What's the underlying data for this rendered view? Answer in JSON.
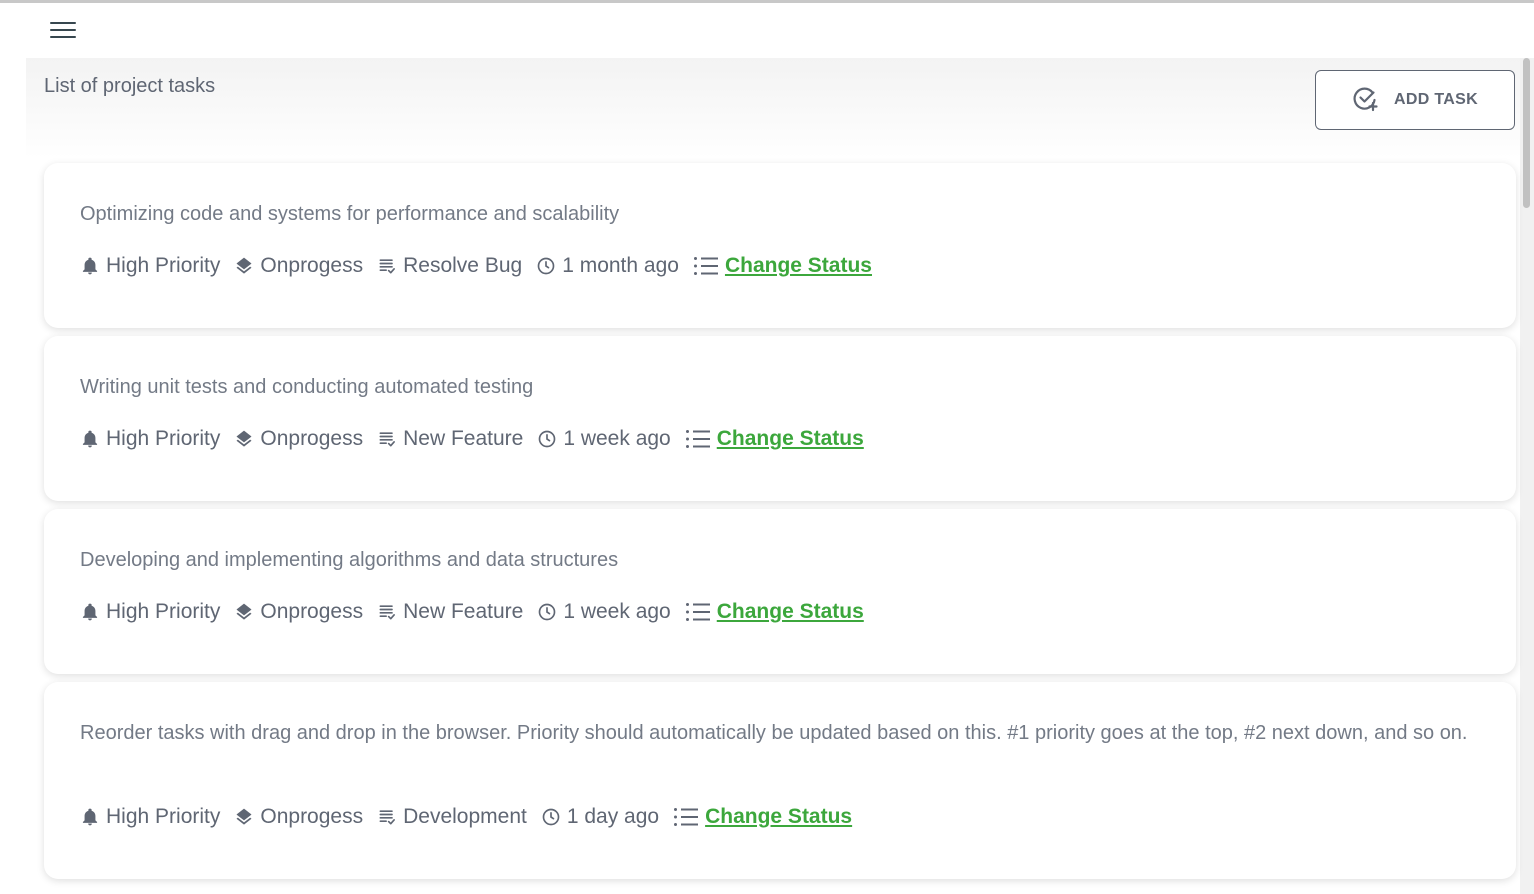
{
  "header": {
    "title": "List of project tasks",
    "add_button_label": "ADD TASK"
  },
  "colors": {
    "accent_green": "#3ca73c",
    "text_gray": "#5f6673"
  },
  "tasks": [
    {
      "description": "Optimizing code and systems for performance and scalability",
      "priority": "High Priority",
      "status": "Onprogess",
      "type": "Resolve Bug",
      "time": "1 month ago",
      "action": "Change Status"
    },
    {
      "description": "Writing unit tests and conducting automated testing",
      "priority": "High Priority",
      "status": "Onprogess",
      "type": "New Feature",
      "time": "1 week ago",
      "action": "Change Status"
    },
    {
      "description": "Developing and implementing algorithms and data structures",
      "priority": "High Priority",
      "status": "Onprogess",
      "type": "New Feature",
      "time": "1 week ago",
      "action": "Change Status"
    },
    {
      "description": "Reorder tasks with drag and drop in the browser. Priority should automatically be updated based on this. #1 priority goes at the top, #2 next down, and so on.",
      "priority": "High Priority",
      "status": "Onprogess",
      "type": "Development",
      "time": "1 day ago",
      "action": "Change Status"
    }
  ]
}
